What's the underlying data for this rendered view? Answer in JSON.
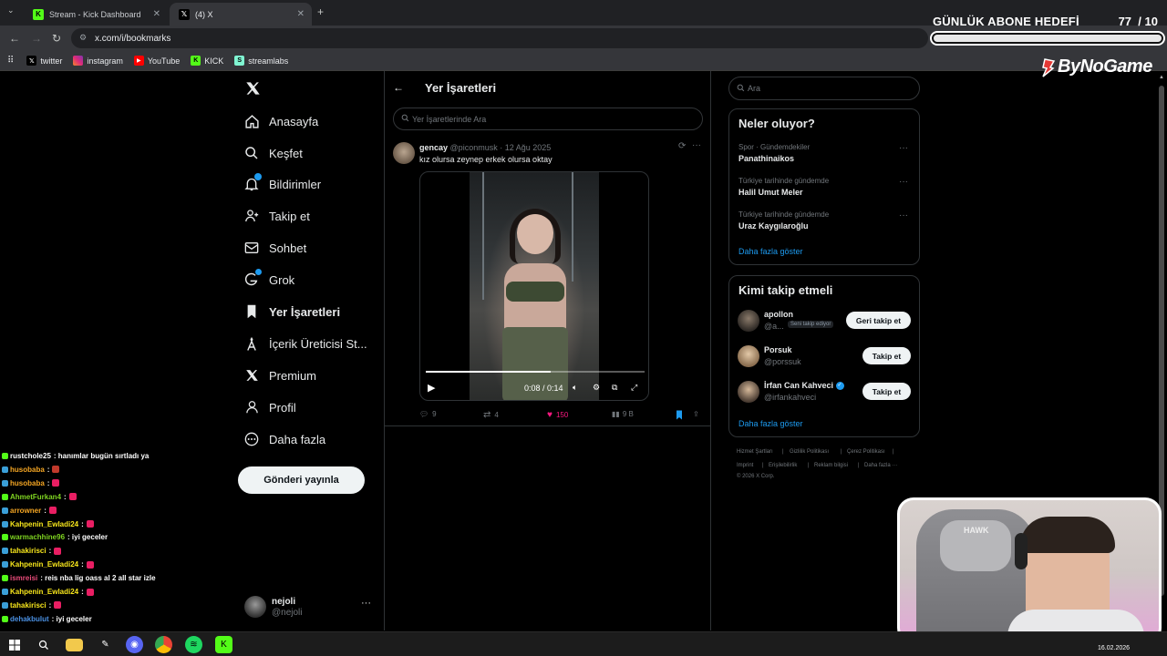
{
  "browser": {
    "tabs": [
      {
        "label": "Stream - Kick Dashboard",
        "active": false
      },
      {
        "label": "(4) X",
        "active": true
      }
    ],
    "url": "x.com/i/bookmarks",
    "bookmarks": [
      {
        "label": "twitter",
        "icon": "x-logo-icon"
      },
      {
        "label": "instagram",
        "icon": "instagram-icon"
      },
      {
        "label": "YouTube",
        "icon": "youtube-icon"
      },
      {
        "label": "KICK",
        "icon": "kick-icon"
      },
      {
        "label": "streamlabs",
        "icon": "streamlabs-icon"
      }
    ]
  },
  "overlay": {
    "goal_title": "GÜNLÜK ABONE HEDEFİ",
    "goal_current": "77",
    "goal_sep": "/",
    "goal_target": "10",
    "brand": "ByNoGame"
  },
  "nav": {
    "items": [
      {
        "label": "Anasayfa",
        "icon": "home-icon"
      },
      {
        "label": "Keşfet",
        "icon": "search-icon"
      },
      {
        "label": "Bildirimler",
        "icon": "bell-icon"
      },
      {
        "label": "Takip et",
        "icon": "follow-icon"
      },
      {
        "label": "Sohbet",
        "icon": "mail-icon"
      },
      {
        "label": "Grok",
        "icon": "grok-icon"
      },
      {
        "label": "Yer İşaretleri",
        "icon": "bookmark-icon"
      },
      {
        "label": "İçerik Üreticisi St...",
        "icon": "creator-icon"
      },
      {
        "label": "Premium",
        "icon": "x-logo-icon"
      },
      {
        "label": "Profil",
        "icon": "profile-icon"
      },
      {
        "label": "Daha fazla",
        "icon": "more-icon"
      }
    ],
    "post_button": "Gönderi yayınla",
    "account_name": "nejoli",
    "account_handle": "@nejoli"
  },
  "center": {
    "title": "Yer İşaretleri",
    "search_placeholder": "Yer İşaretlerinde Ara",
    "tweet": {
      "author": "gencay",
      "handle": "@piconmusk",
      "date": "· 12 Ağu 2025",
      "text": "kız olursa zeynep erkek olursa oktay",
      "video_time": "0:08 / 0:14",
      "video_progress": 0.57,
      "replies": "9",
      "retweets": "4",
      "likes": "150",
      "views": "9 B"
    }
  },
  "right": {
    "search_placeholder": "Ara",
    "trends_title": "Neler oluyor?",
    "trends": [
      {
        "category": "Spor · Gündemdekiler",
        "name": "Panathinaikos"
      },
      {
        "category": "Türkiye tarihinde gündemde",
        "name": "Halil Umut Meler"
      },
      {
        "category": "Türkiye tarihinde gündemde",
        "name": "Uraz Kaygılaroğlu"
      }
    ],
    "trends_more": "Daha fazla göster",
    "who_title": "Kimi takip etmeli",
    "who": [
      {
        "name": "apollon",
        "handle": "@a...",
        "badge": "Seni takip ediyor",
        "button": "Geri takip et"
      },
      {
        "name": "Porsuk",
        "handle": "@porssuk",
        "button": "Takip et"
      },
      {
        "name": "İrfan Can Kahveci",
        "handle": "@irfankahveci",
        "button": "Takip et"
      }
    ],
    "who_more": "Daha fazla göster",
    "footer": [
      "Hizmet Şartları",
      "|",
      "Gizlilik Politikası",
      "|",
      "Çerez Politikası",
      "|",
      "Imprint",
      "|",
      "Erişilebilirlik",
      "|",
      "Reklam bilgisi",
      "|",
      "Daha fazla ···",
      "© 2026 X Corp."
    ]
  },
  "chat": [
    {
      "user": "rustchole25",
      "msg": ": hanımlar bugün sırtladı ya",
      "color": "#ffffff"
    },
    {
      "user": "husobaba",
      "msg": ":",
      "color": "#f5a623"
    },
    {
      "user": "husobaba",
      "msg": ":",
      "color": "#f5a623"
    },
    {
      "user": "AhmetFurkan4",
      "msg": ":",
      "color": "#7ed321"
    },
    {
      "user": "arrowner",
      "msg": ":",
      "color": "#f5a623"
    },
    {
      "user": "Kahpenin_Ewladi24",
      "msg": ":",
      "color": "#f8e71c"
    },
    {
      "user": "warmachhine96",
      "msg": ": iyi geceler",
      "color": "#7ed321"
    },
    {
      "user": "tahakirisci",
      "msg": ":",
      "color": "#f8e71c"
    },
    {
      "user": "Kahpenin_Ewladi24",
      "msg": ":",
      "color": "#f8e71c"
    },
    {
      "user": "ismreisi",
      "msg": ": reis nba lig oass al 2 all star izle",
      "color": "#e94b7a"
    },
    {
      "user": "Kahpenin_Ewladi24",
      "msg": ":",
      "color": "#f8e71c"
    },
    {
      "user": "tahakirisci",
      "msg": ":",
      "color": "#f8e71c"
    },
    {
      "user": "dehakbulut",
      "msg": ": iyi geceler",
      "color": "#4a90e2"
    }
  ],
  "taskbar": {
    "date": "16.02.2026"
  },
  "colors": {
    "accent": "#1d9bf0",
    "like": "#f91880",
    "background": "#000000"
  }
}
